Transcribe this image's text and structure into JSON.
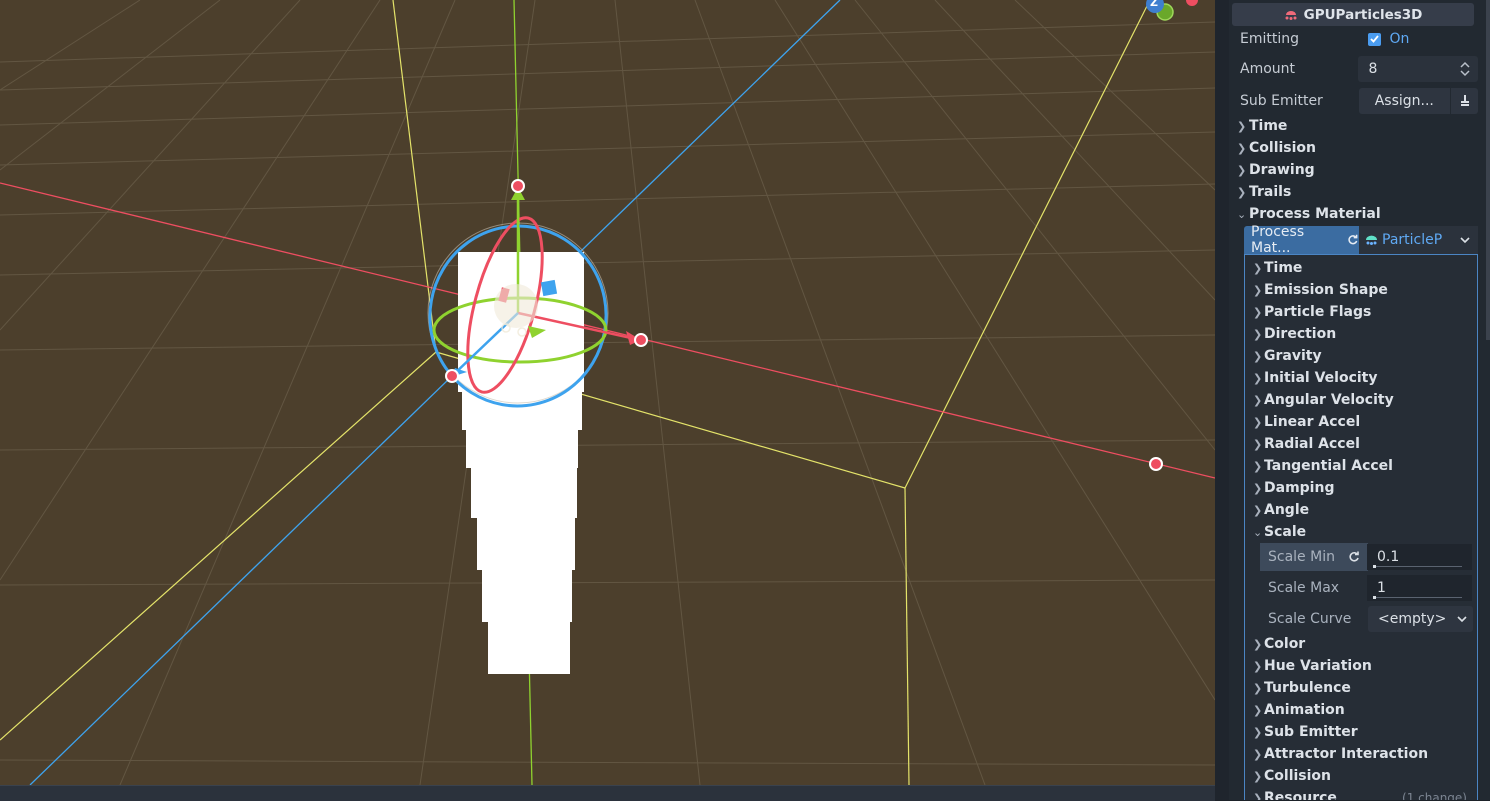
{
  "inspector": {
    "node_type": "GPUParticles3D",
    "properties": [
      {
        "label": "Emitting",
        "value": "On"
      },
      {
        "label": "Amount",
        "value": "8"
      },
      {
        "label": "Sub Emitter",
        "value": "Assign..."
      }
    ],
    "sections": [
      "Time",
      "Collision",
      "Drawing",
      "Trails",
      "Process Material"
    ],
    "process_material": {
      "resource_name": "Process Mat...",
      "resource_type": "ParticleP",
      "sections_before_scale": [
        "Time",
        "Emission Shape",
        "Particle Flags",
        "Direction",
        "Gravity",
        "Initial Velocity",
        "Angular Velocity",
        "Linear Accel",
        "Radial Accel",
        "Tangential Accel",
        "Damping",
        "Angle"
      ],
      "scale_section": "Scale",
      "scale_props": [
        {
          "label": "Scale Min",
          "value": "0.1"
        },
        {
          "label": "Scale Max",
          "value": "1"
        },
        {
          "label": "Scale Curve",
          "value": "<empty>"
        }
      ],
      "sections_after_scale": [
        "Color",
        "Hue Variation",
        "Turbulence",
        "Animation",
        "Sub Emitter",
        "Attractor Interaction",
        "Collision",
        "Resource"
      ],
      "resource_change_note": "(1 change)"
    }
  },
  "viewport": {
    "axis_label": "Z",
    "colors": {
      "x_axis": "#ee4e61",
      "y_axis": "#8fd22f",
      "z_axis": "#3ea3ee",
      "bounds": "#e4e36a",
      "ground": "#4c3f2c"
    }
  }
}
